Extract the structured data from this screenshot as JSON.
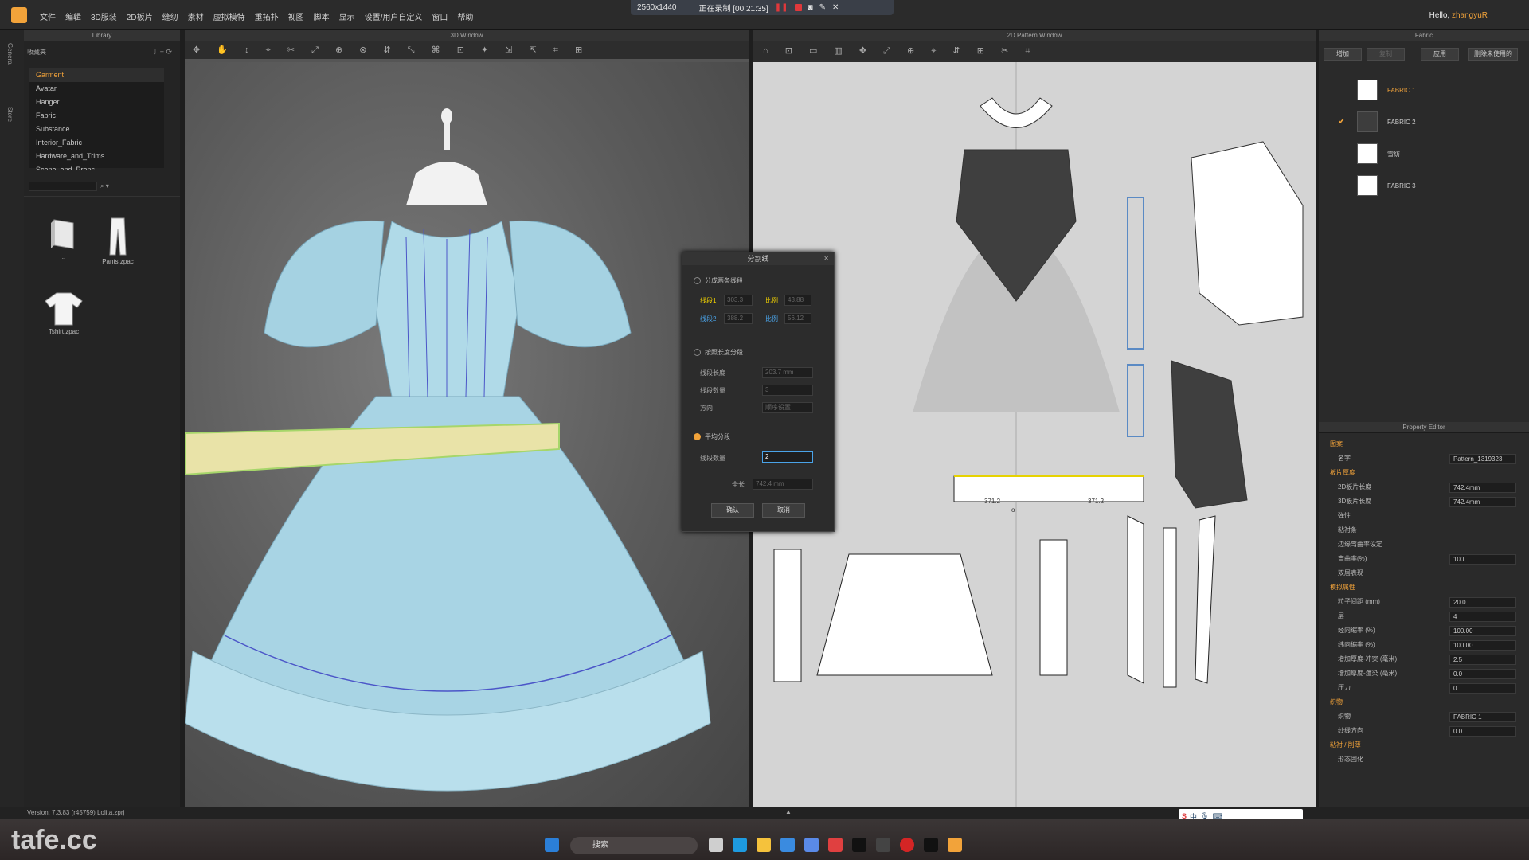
{
  "menubar": {
    "items": [
      "文件",
      "编辑",
      "3D服装",
      "2D板片",
      "缝纫",
      "素材",
      "虚拟模特",
      "重拓扑",
      "视图",
      "脚本",
      "显示",
      "设置/用户自定义",
      "窗口",
      "帮助"
    ],
    "resolution": "2560x1440",
    "recording": "正在录制 [00:21:35]",
    "hello": "Hello,",
    "user": "zhangyuR"
  },
  "panels": {
    "library": "Library",
    "view3d": "3D Window",
    "view2d": "2D Pattern Window",
    "fabric": "Fabric",
    "property": "Property Editor"
  },
  "leftstrip": {
    "general": "General",
    "store": "Store"
  },
  "library": {
    "folder_label": "收藏夹",
    "tree": [
      "Garment",
      "Avatar",
      "Hanger",
      "Fabric",
      "Substance",
      "Interior_Fabric",
      "Hardware_and_Trims",
      "Scene_and_Props"
    ],
    "thumbs": [
      "..",
      "Pants.zpac",
      "Tshirt.zpac"
    ]
  },
  "fabric": {
    "buttons": [
      "增加",
      "复制",
      "应用",
      "删除未使用的"
    ],
    "items": [
      {
        "name": "FABRIC 1",
        "color": "#f2a33a",
        "dark": false,
        "checked": false
      },
      {
        "name": "FABRIC 2",
        "color": "#cccccc",
        "dark": true,
        "checked": true
      },
      {
        "name": "雪纺",
        "color": "#cccccc",
        "dark": false,
        "checked": false
      },
      {
        "name": "FABRIC 3",
        "color": "#cccccc",
        "dark": false,
        "checked": false
      }
    ]
  },
  "dialog": {
    "title": "分割线",
    "opt1": "分成两条线段",
    "seg1": "线段1",
    "seg2": "线段2",
    "ratio": "比例",
    "seg1_len": "303.3",
    "seg2_len": "388.2",
    "ratio1": "43.88",
    "ratio2": "56.12",
    "opt2": "按照长度分段",
    "seg_length": "线段长度",
    "seg_length_val": "203.7 mm",
    "seg_count": "线段数量",
    "seg_count_val": "3",
    "direction": "方向",
    "direction_val": "顺序设置",
    "opt3": "平均分段",
    "avg_count": "线段数量",
    "avg_count_val": "2",
    "total": "全长",
    "total_val": "742.4 mm",
    "confirm": "确认",
    "cancel": "取消"
  },
  "pattern": {
    "label_left": "371.2",
    "label_right": "371.2"
  },
  "property": {
    "rows": [
      {
        "label": "图案",
        "value": "",
        "section": true
      },
      {
        "label": "名字",
        "value": "Pattern_1319323"
      },
      {
        "label": "板片厚度",
        "value": "",
        "section": true
      },
      {
        "label": "2D板片长度",
        "value": "742.4mm"
      },
      {
        "label": "3D板片长度",
        "value": "742.4mm"
      },
      {
        "label": "弹性",
        "value": ""
      },
      {
        "label": "粘衬条",
        "value": ""
      },
      {
        "label": "边缘弯曲率设定",
        "value": ""
      },
      {
        "label": "弯曲率(%)",
        "value": "100"
      },
      {
        "label": "双层表现",
        "value": ""
      },
      {
        "label": "模拟属性",
        "value": "",
        "section": true
      },
      {
        "label": "粒子间距 (mm)",
        "value": "20.0"
      },
      {
        "label": "层",
        "value": "4"
      },
      {
        "label": "经向缩率 (%)",
        "value": "100.00"
      },
      {
        "label": "纬向缩率 (%)",
        "value": "100.00"
      },
      {
        "label": "增加厚度-冲突 (毫米)",
        "value": "2.5"
      },
      {
        "label": "增加厚度-渲染 (毫米)",
        "value": "0.0"
      },
      {
        "label": "压力",
        "value": "0"
      },
      {
        "label": "织物",
        "value": "",
        "section": true
      },
      {
        "label": "织物",
        "value": "FABRIC 1"
      },
      {
        "label": "纱线方向",
        "value": "0.0"
      },
      {
        "label": "粘衬 / 削薄",
        "value": "",
        "section": true
      },
      {
        "label": "形态固化",
        "value": ""
      }
    ]
  },
  "statusbar": {
    "version": "Version:  7.3.83 (r45759)   Lolita.zprj"
  },
  "taskbar": {
    "search": "搜索",
    "watermark": "tafe.cc",
    "ime": "中"
  }
}
